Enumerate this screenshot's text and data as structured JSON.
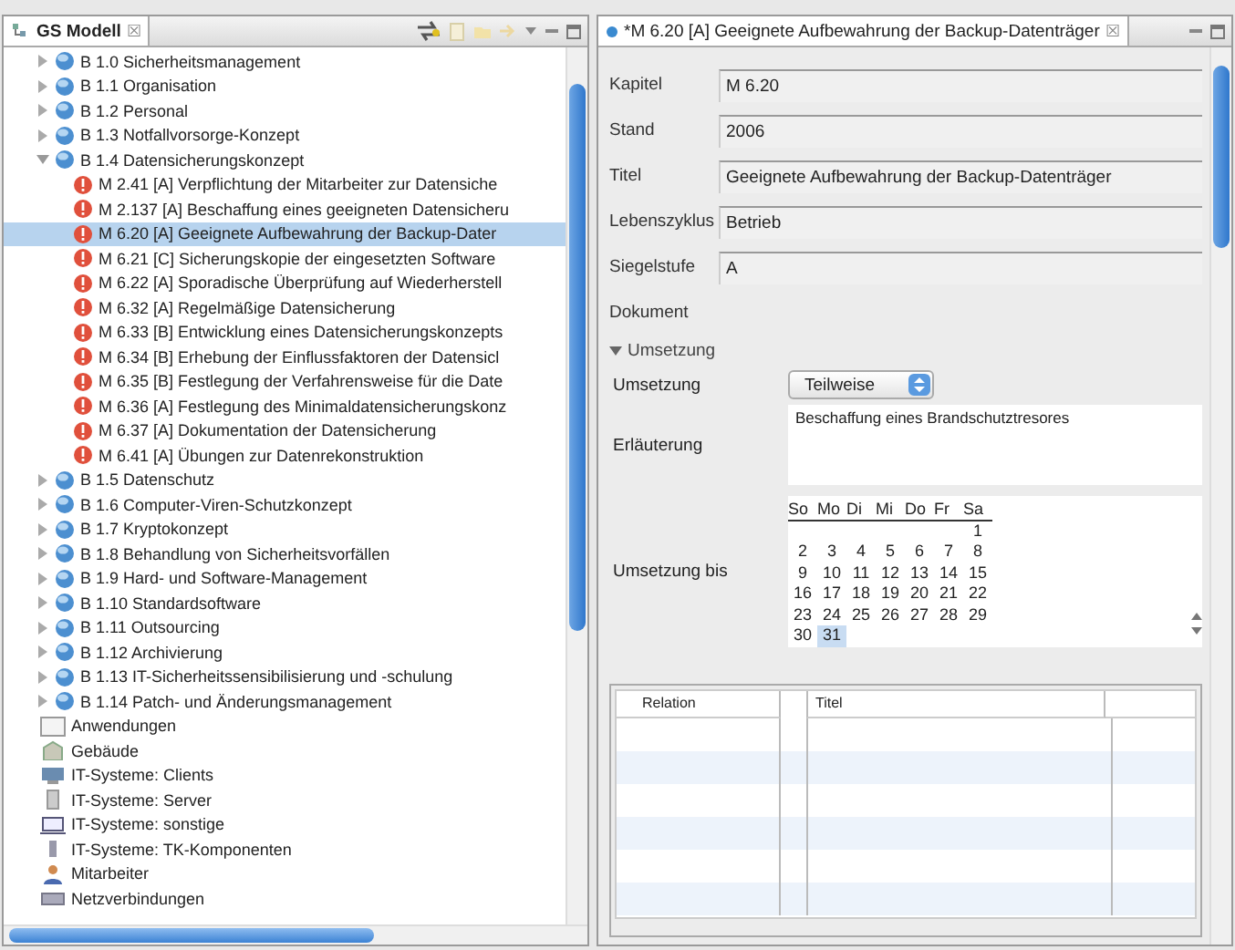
{
  "left_panel": {
    "title": "GS Modell",
    "close": "☒"
  },
  "tree": [
    {
      "label": "B 1.0 Sicherheitsmanagement",
      "kind": "baustein",
      "expanded": false,
      "selected": false
    },
    {
      "label": "B 1.1 Organisation",
      "kind": "baustein",
      "expanded": false,
      "selected": false
    },
    {
      "label": "B 1.2 Personal",
      "kind": "baustein",
      "expanded": false,
      "selected": false
    },
    {
      "label": "B 1.3 Notfallvorsorge-Konzept",
      "kind": "baustein",
      "expanded": false,
      "selected": false
    },
    {
      "label": "B 1.4 Datensicherungskonzept",
      "kind": "baustein",
      "expanded": true,
      "selected": false,
      "children": [
        {
          "label": "M 2.41 [A] Verpflichtung der Mitarbeiter zur Datensiche",
          "kind": "massnahme",
          "selected": false
        },
        {
          "label": "M 2.137 [A] Beschaffung eines geeigneten Datensicheru",
          "kind": "massnahme",
          "selected": false
        },
        {
          "label": "M 6.20 [A] Geeignete Aufbewahrung der Backup-Dater",
          "kind": "massnahme",
          "selected": true
        },
        {
          "label": "M 6.21 [C] Sicherungskopie der eingesetzten Software",
          "kind": "massnahme",
          "selected": false
        },
        {
          "label": "M 6.22 [A] Sporadische Überprüfung auf Wiederherstell",
          "kind": "massnahme",
          "selected": false
        },
        {
          "label": "M 6.32 [A] Regelmäßige Datensicherung",
          "kind": "massnahme",
          "selected": false
        },
        {
          "label": "M 6.33 [B] Entwicklung eines Datensicherungskonzepts",
          "kind": "massnahme",
          "selected": false
        },
        {
          "label": "M 6.34 [B] Erhebung der Einflussfaktoren der Datensicl",
          "kind": "massnahme",
          "selected": false
        },
        {
          "label": "M 6.35 [B] Festlegung der Verfahrensweise für die Date",
          "kind": "massnahme",
          "selected": false
        },
        {
          "label": "M 6.36 [A] Festlegung des Minimaldatensicherungskonz",
          "kind": "massnahme",
          "selected": false
        },
        {
          "label": "M 6.37 [A] Dokumentation der Datensicherung",
          "kind": "massnahme",
          "selected": false
        },
        {
          "label": "M 6.41 [A] Übungen zur Datenrekonstruktion",
          "kind": "massnahme",
          "selected": false
        }
      ]
    },
    {
      "label": "B 1.5 Datenschutz",
      "kind": "baustein",
      "expanded": false,
      "selected": false
    },
    {
      "label": "B 1.6 Computer-Viren-Schutzkonzept",
      "kind": "baustein",
      "expanded": false,
      "selected": false
    },
    {
      "label": "B 1.7 Kryptokonzept",
      "kind": "baustein",
      "expanded": false,
      "selected": false
    },
    {
      "label": "B 1.8 Behandlung von Sicherheitsvorfällen",
      "kind": "baustein",
      "expanded": false,
      "selected": false
    },
    {
      "label": "B 1.9 Hard- und Software-Management",
      "kind": "baustein",
      "expanded": false,
      "selected": false
    },
    {
      "label": "B 1.10 Standardsoftware",
      "kind": "baustein",
      "expanded": false,
      "selected": false
    },
    {
      "label": "B 1.11 Outsourcing",
      "kind": "baustein",
      "expanded": false,
      "selected": false
    },
    {
      "label": "B 1.12 Archivierung",
      "kind": "baustein",
      "expanded": false,
      "selected": false
    },
    {
      "label": "B 1.13 IT-Sicherheitssensibilisierung und -schulung",
      "kind": "baustein",
      "expanded": false,
      "selected": false
    },
    {
      "label": "B 1.14 Patch- und Änderungsmanagement",
      "kind": "baustein",
      "expanded": false,
      "selected": false
    },
    {
      "label": "Anwendungen",
      "kind": "apps",
      "selected": false
    },
    {
      "label": "Gebäude",
      "kind": "building",
      "selected": false
    },
    {
      "label": "IT-Systeme: Clients",
      "kind": "client",
      "selected": false
    },
    {
      "label": "IT-Systeme: Server",
      "kind": "server",
      "selected": false
    },
    {
      "label": "IT-Systeme: sonstige",
      "kind": "other",
      "selected": false
    },
    {
      "label": "IT-Systeme: TK-Komponenten",
      "kind": "phone",
      "selected": false
    },
    {
      "label": "Mitarbeiter",
      "kind": "person",
      "selected": false
    },
    {
      "label": "Netzverbindungen",
      "kind": "network",
      "selected": false
    }
  ],
  "editor": {
    "title": "*M 6.20 [A] Geeignete Aufbewahrung der Backup-Datenträger",
    "close": "☒",
    "fields": [
      {
        "label": "Kapitel",
        "value": "M 6.20"
      },
      {
        "label": "Stand",
        "value": "2006"
      },
      {
        "label": "Titel",
        "value": "Geeignete Aufbewahrung der Backup-Datenträger"
      },
      {
        "label": "Lebenszyklus",
        "value": "Betrieb"
      },
      {
        "label": "Siegelstufe",
        "value": "A"
      }
    ],
    "document_label": "Dokument",
    "section": {
      "label": "Umsetzung",
      "expanded": true,
      "umsetzung": {
        "label": "Umsetzung",
        "value": "Teilweise"
      },
      "erlaeuterung": {
        "label": "Erläuterung",
        "value": "Beschaffung eines Brandschutztresores"
      },
      "umsetzung_bis": {
        "label": "Umsetzung bis",
        "weekdays": [
          "So",
          "Mo",
          "Di",
          "Mi",
          "Do",
          "Fr",
          "Sa"
        ],
        "days": [
          {
            "day": "1",
            "selected": false
          },
          {
            "day": "2",
            "selected": false
          },
          {
            "day": "3",
            "selected": false
          },
          {
            "day": "4",
            "selected": false
          },
          {
            "day": "5",
            "selected": false
          },
          {
            "day": "6",
            "selected": false
          },
          {
            "day": "7",
            "selected": false
          },
          {
            "day": "8",
            "selected": false
          },
          {
            "day": "9",
            "selected": false
          },
          {
            "day": "10",
            "selected": false
          },
          {
            "day": "11",
            "selected": false
          },
          {
            "day": "12",
            "selected": false
          },
          {
            "day": "13",
            "selected": false
          },
          {
            "day": "14",
            "selected": false
          },
          {
            "day": "15",
            "selected": false
          },
          {
            "day": "16",
            "selected": false
          },
          {
            "day": "17",
            "selected": false
          },
          {
            "day": "18",
            "selected": false
          },
          {
            "day": "19",
            "selected": false
          },
          {
            "day": "20",
            "selected": false
          },
          {
            "day": "21",
            "selected": false
          },
          {
            "day": "22",
            "selected": false
          },
          {
            "day": "23",
            "selected": false
          },
          {
            "day": "24",
            "selected": false
          },
          {
            "day": "25",
            "selected": false
          },
          {
            "day": "26",
            "selected": false
          },
          {
            "day": "27",
            "selected": false
          },
          {
            "day": "28",
            "selected": false
          },
          {
            "day": "29",
            "selected": false
          },
          {
            "day": "30",
            "selected": false
          },
          {
            "day": "31",
            "selected": true
          }
        ]
      }
    },
    "table": {
      "columns": [
        "Relation",
        "Titel"
      ]
    }
  }
}
